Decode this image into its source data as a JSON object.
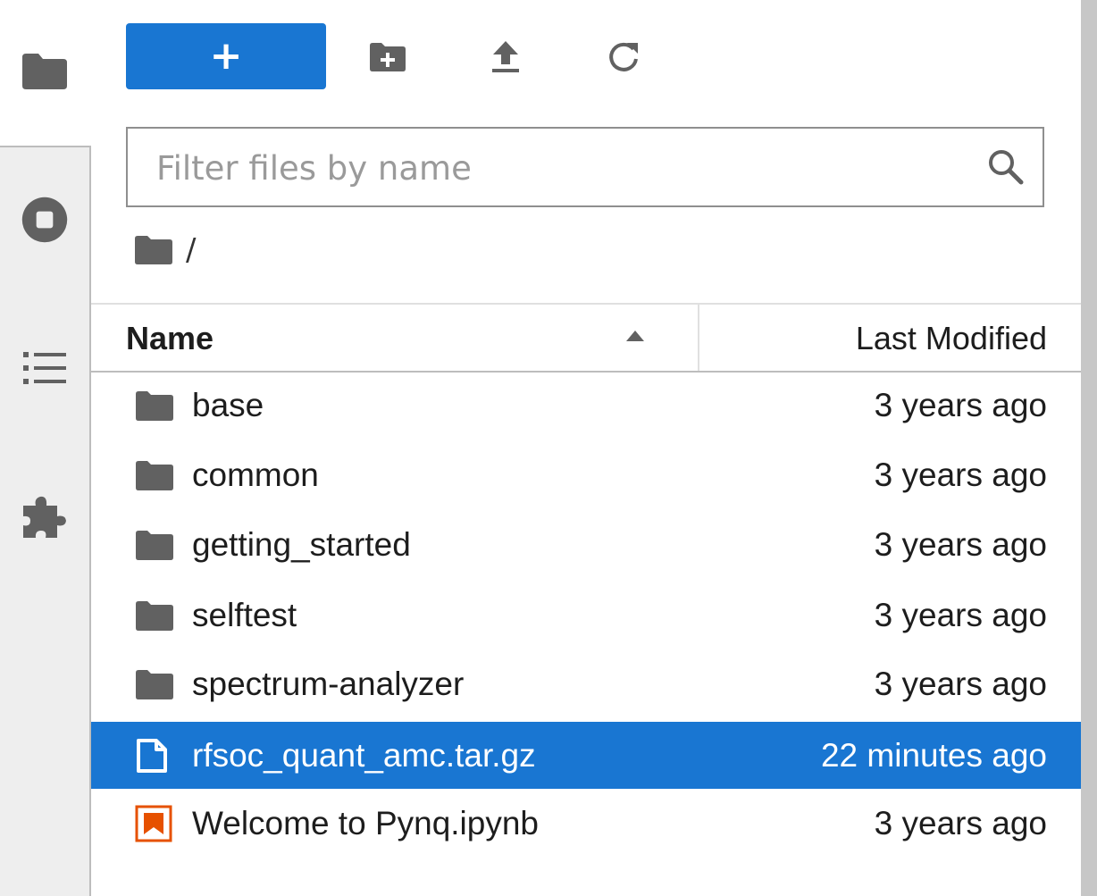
{
  "colors": {
    "accent": "#1976d2",
    "notebook_icon": "#e65100",
    "sidebar_bg": "#eeeeee"
  },
  "sidebar": {
    "items": [
      {
        "icon": "folder-icon",
        "active": true
      },
      {
        "icon": "stop-circle-icon"
      },
      {
        "icon": "list-icon"
      },
      {
        "icon": "puzzle-piece-icon"
      }
    ]
  },
  "toolbar": {
    "new_label": "+",
    "new_folder_icon": "new-folder-icon",
    "upload_icon": "upload-icon",
    "refresh_icon": "refresh-icon"
  },
  "filter": {
    "placeholder": "Filter files by name",
    "value": ""
  },
  "breadcrumb": {
    "path": "/"
  },
  "columns": {
    "name": "Name",
    "modified": "Last Modified",
    "sort": "ascending"
  },
  "files": [
    {
      "name": "base",
      "modified": "3 years ago",
      "type": "folder",
      "selected": false
    },
    {
      "name": "common",
      "modified": "3 years ago",
      "type": "folder",
      "selected": false
    },
    {
      "name": "getting_started",
      "modified": "3 years ago",
      "type": "folder",
      "selected": false
    },
    {
      "name": "selftest",
      "modified": "3 years ago",
      "type": "folder",
      "selected": false
    },
    {
      "name": "spectrum-analyzer",
      "modified": "3 years ago",
      "type": "folder",
      "selected": false
    },
    {
      "name": "rfsoc_quant_amc.tar.gz",
      "modified": "22 minutes ago",
      "type": "file",
      "selected": true
    },
    {
      "name": "Welcome to Pynq.ipynb",
      "modified": "3 years ago",
      "type": "notebook",
      "selected": false
    }
  ]
}
